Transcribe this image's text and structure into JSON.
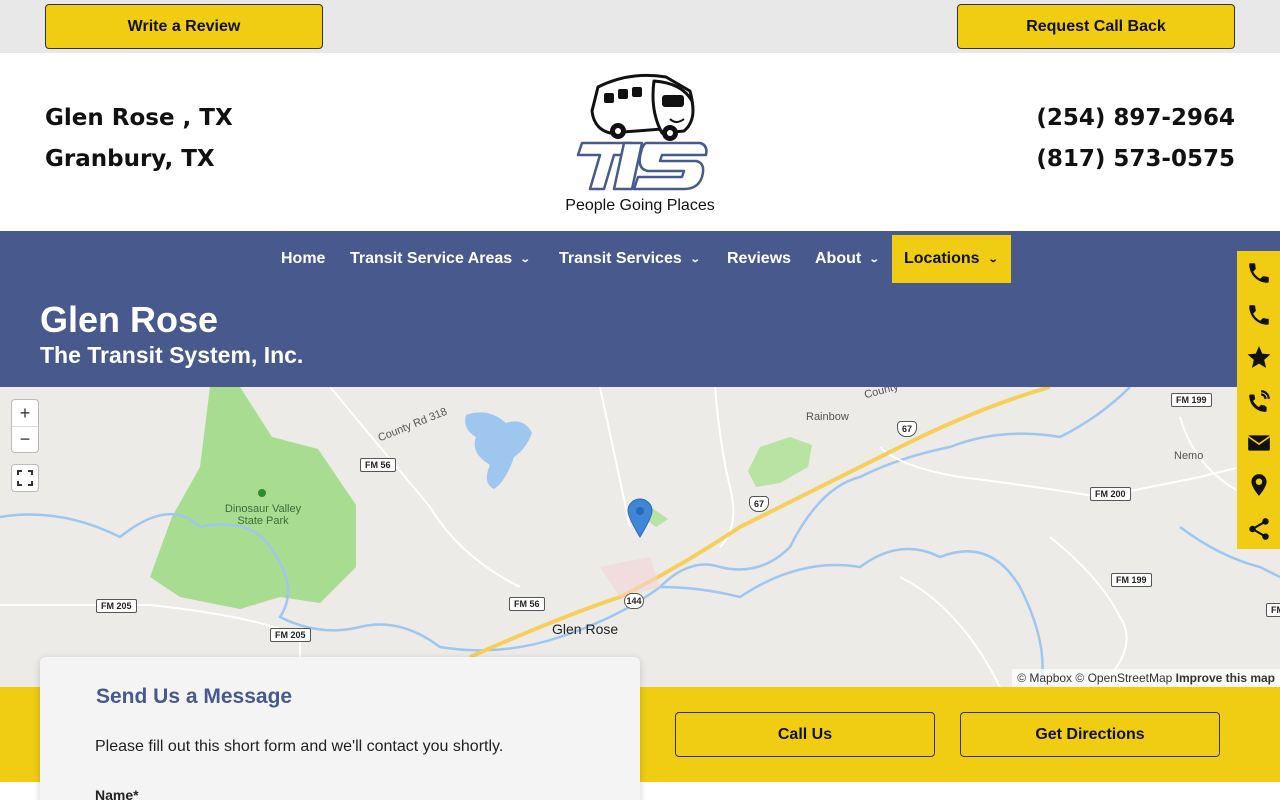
{
  "topbar": {
    "review_label": "Write a Review",
    "callback_label": "Request Call Back"
  },
  "header": {
    "locations": [
      "Glen Rose , TX",
      "Granbury, TX"
    ],
    "phones": [
      "(254) 897-2964",
      "(817) 573-0575"
    ],
    "logo_text": "TTS",
    "tagline": "People Going Places"
  },
  "nav": {
    "items": [
      {
        "label": "Home",
        "has_dropdown": false
      },
      {
        "label": "Transit Service Areas",
        "has_dropdown": true
      },
      {
        "label": "Transit Services",
        "has_dropdown": true
      },
      {
        "label": "Reviews",
        "has_dropdown": false
      },
      {
        "label": "About",
        "has_dropdown": true
      },
      {
        "label": "Locations",
        "has_dropdown": true,
        "active": true
      }
    ]
  },
  "page": {
    "title": "Glen Rose",
    "subtitle": "The Transit System, Inc."
  },
  "sidebar": {
    "icons": [
      "phone-icon",
      "phone-icon",
      "star-icon",
      "phone-ringing-icon",
      "envelope-icon",
      "map-marker-icon",
      "share-icon"
    ]
  },
  "map": {
    "zoom_in": "+",
    "zoom_out": "−",
    "labels": {
      "county_rd_318": "County Rd 318",
      "county": "County",
      "rainbow": "Rainbow",
      "nemo": "Nemo",
      "park": "Dinosaur Valley State Park",
      "town": "Glen Rose"
    },
    "shields": {
      "fm56_a": "FM 56",
      "fm56_b": "FM 56",
      "fm199_a": "FM 199",
      "fm199_b": "FM 199",
      "fm200": "FM 200",
      "fm205_a": "FM 205",
      "fm205_b": "FM 205",
      "us67_a": "67",
      "us67_b": "67",
      "sh144": "144",
      "fm_edge": "FM"
    },
    "attribution": {
      "mapbox": "© Mapbox",
      "osm": "© OpenStreetMap",
      "improve": "Improve this map"
    }
  },
  "cta": {
    "call_label": "Call Us",
    "directions_label": "Get Directions"
  },
  "form": {
    "title": "Send Us a Message",
    "description": "Please fill out this short form and we'll contact you shortly.",
    "name_label": "Name*"
  },
  "colors": {
    "brand_blue": "#485a8d",
    "accent_yellow": "#f0cd12",
    "water": "#9fc6ee",
    "park": "#a8dc90"
  }
}
